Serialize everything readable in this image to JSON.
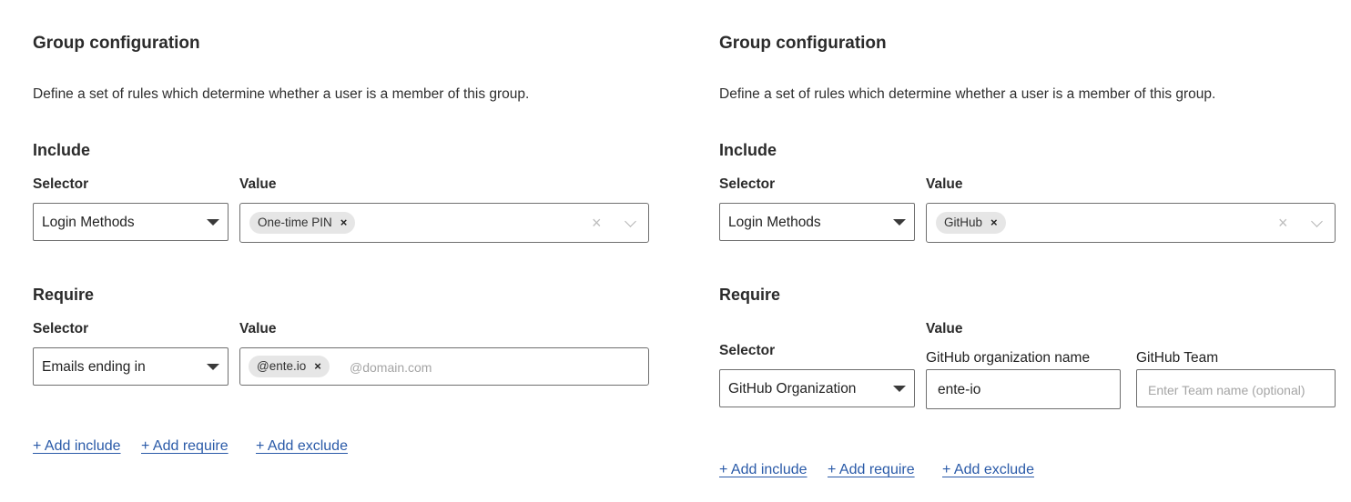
{
  "left": {
    "title": "Group configuration",
    "description": "Define a set of rules which determine whether a user is a member of this group.",
    "include": {
      "heading": "Include",
      "selector_label": "Selector",
      "value_label": "Value",
      "selector_value": "Login Methods",
      "chips": [
        "One-time PIN"
      ],
      "chip_remove": "×",
      "clear": "×"
    },
    "require": {
      "heading": "Require",
      "selector_label": "Selector",
      "value_label": "Value",
      "selector_value": "Emails ending in",
      "chips": [
        "@ente.io"
      ],
      "chip_remove": "×",
      "placeholder": "@domain.com"
    },
    "actions": {
      "add_include": "+ Add include",
      "add_require": "+ Add require",
      "add_exclude": "+ Add exclude"
    }
  },
  "right": {
    "title": "Group configuration",
    "description": "Define a set of rules which determine whether a user is a member of this group.",
    "include": {
      "heading": "Include",
      "selector_label": "Selector",
      "value_label": "Value",
      "selector_value": "Login Methods",
      "chips": [
        "GitHub"
      ],
      "chip_remove": "×",
      "clear": "×"
    },
    "require": {
      "heading": "Require",
      "selector_label": "Selector",
      "value_label": "Value",
      "selector_value": "GitHub Organization",
      "org_label": "GitHub organization name",
      "org_value": "ente-io",
      "team_label": "GitHub Team",
      "team_placeholder": "Enter Team name (optional)"
    },
    "actions": {
      "add_include": "+ Add include",
      "add_require": "+ Add require",
      "add_exclude": "+ Add exclude"
    }
  }
}
